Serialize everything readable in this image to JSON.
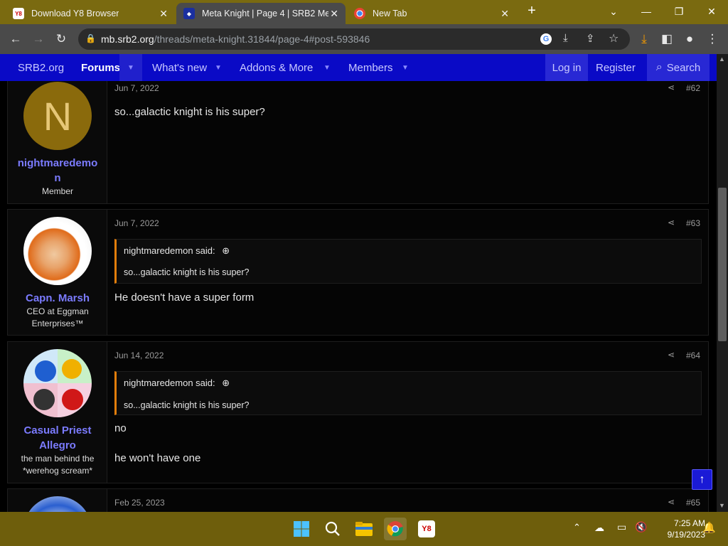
{
  "browser": {
    "tabs": [
      {
        "title": "Download Y8 Browser",
        "favicon": "y8"
      },
      {
        "title": "Meta Knight | Page 4 | SRB2 Mes",
        "favicon": "srb2"
      },
      {
        "title": "New Tab",
        "favicon": "chrome"
      }
    ],
    "url_host": "mb.srb2.org",
    "url_path": "/threads/meta-knight.31844/page-4#post-593846"
  },
  "nav": {
    "logo": "SRB2.org",
    "forums": "Forums",
    "whats_new": "What's new",
    "addons": "Addons & More",
    "members": "Members",
    "login": "Log in",
    "register": "Register",
    "search": "Search"
  },
  "posts": [
    {
      "initial": "N",
      "username_line1": "nightmaredemo",
      "username_line2": "n",
      "user_title": "Member",
      "date": "Jun 7, 2022",
      "number": "#62",
      "body": "so...galactic knight is his super?"
    },
    {
      "username": "Capn. Marsh",
      "user_title_line1": "CEO at Eggman",
      "user_title_line2": "Enterprises™",
      "date": "Jun 7, 2022",
      "number": "#63",
      "quote_author": "nightmaredemon said:",
      "quote_body": "so...galactic knight is his super?",
      "body": "He doesn't have a super form"
    },
    {
      "username_line1": "Casual Priest",
      "username_line2": "Allegro",
      "user_title_line1": "the man behind the",
      "user_title_line2": "*werehog scream*",
      "date": "Jun 14, 2022",
      "number": "#64",
      "quote_author": "nightmaredemon said:",
      "quote_body": "so...galactic knight is his super?",
      "body_line1": "no",
      "body_line2": "he won't have one"
    },
    {
      "date": "Feb 25, 2023",
      "number": "#65"
    }
  ],
  "taskbar": {
    "time": "7:25 AM",
    "date": "9/19/2023"
  },
  "colors": {
    "nav_bg": "#0a0ac6",
    "username": "#7b7bff",
    "quote_accent": "#e17d0b",
    "taskbar": "#6e5e0c"
  }
}
